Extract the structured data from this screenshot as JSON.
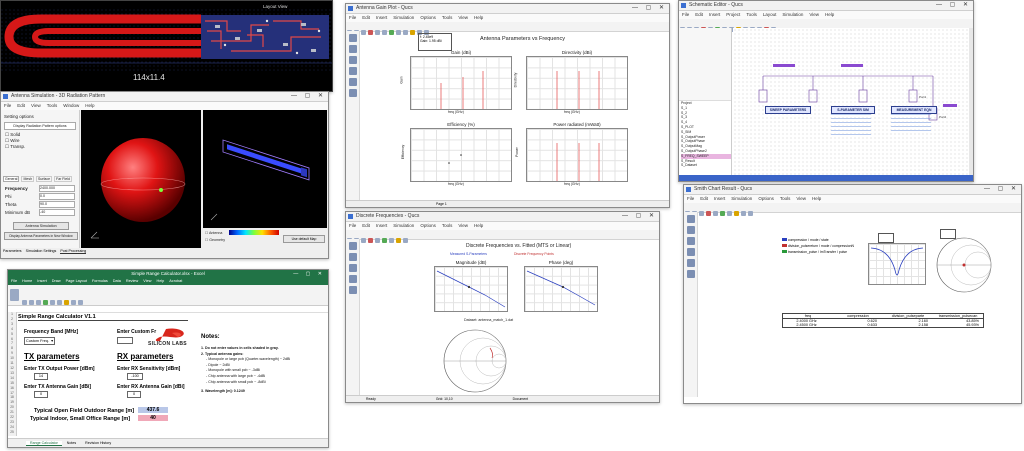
{
  "pcb": {
    "dim_label": "114x11.4",
    "header_label": "Layout View"
  },
  "sim3d": {
    "title": "Antenna Simulation - 3D Radiation Pattern",
    "menus": [
      "File",
      "Edit",
      "View",
      "Tools",
      "Window",
      "Help"
    ],
    "section": "Setting options",
    "settings_button": "Display Radiation Pattern options",
    "options": [
      "Solid",
      "Wire",
      "Transp."
    ],
    "tabs": [
      "General",
      "Mesh",
      "Surface",
      "Far Field"
    ],
    "fields": [
      {
        "label": "Frequency",
        "value": "2400.000"
      },
      {
        "label": "Phi",
        "value": "0.0"
      },
      {
        "label": "Theta",
        "value": "90.0"
      },
      {
        "label": "Minimum dB",
        "value": "-40"
      }
    ],
    "buttons": [
      "Antenna Simulation",
      "Display Antenna Parameters in New Window"
    ],
    "bottom_tabs": [
      "Parameters",
      "Simulation Settings",
      "Post Processing"
    ],
    "right_bottom": [
      "Antenna",
      "Geometry"
    ],
    "color_button": "Use default Map"
  },
  "excel": {
    "title": "Simple Range Calculator.xlsx - Excel",
    "ribbon_tabs": [
      "File",
      "Home",
      "Insert",
      "Draw",
      "Page Layout",
      "Formulas",
      "Data",
      "Review",
      "View",
      "Help",
      "Acrobat"
    ],
    "sheet_title": "Simple Range Calculator V1.1",
    "freq_label": "Frequency Band [MHz]",
    "freq_value": "Custom Freq.",
    "custom_label": "Enter Custom Fr",
    "brand": "SILICON LABS",
    "tx_header": "TX parameters",
    "rx_header": "RX parameters",
    "tx_power_label": "Enter TX Output Power [dBm]",
    "tx_power": "14",
    "rx_sens_label": "Enter RX Sensitivity [dBm]",
    "rx_sens": "-100",
    "tx_gain_label": "Enter TX Antenna Gain [dBi]",
    "tx_gain": "0",
    "rx_gain_label": "Enter RX Antenna Gain [dBi]",
    "rx_gain": "0",
    "outdoor_label": "Typical Open Field Outdoor Range [m]",
    "outdoor_value": "437.6",
    "indoor_label": "Typical Indoor, Small Office Range [m]",
    "indoor_value": "40",
    "notes_title": "Notes:",
    "notes": [
      "1. Do not enter values in cells shaded in gray.",
      "2. Typical antenna gains:",
      "- Monopole or large pcb (Quarter-wavelength) ~ 2dBi",
      "- Dipole ~ 2dBi",
      "- Monopole with small pcb ~ -3dBi",
      "- Chip antenna with large pcb ~ -4dBi",
      "- Chip antenna with small pcb ~ -8dBi",
      "3. Wavelength [m]:   0.1249"
    ],
    "sheet_tabs": [
      "Range Calculator",
      "Notes",
      "Revision History"
    ],
    "row_numbers": [
      "1",
      "2",
      "3",
      "4",
      "5",
      "6",
      "7",
      "8",
      "9",
      "10",
      "11",
      "12",
      "13",
      "14",
      "15",
      "16",
      "17",
      "18",
      "19",
      "20",
      "21",
      "22",
      "23",
      "24",
      "25"
    ]
  },
  "qucs1": {
    "title": "Antenna Gain Plot - Qucs",
    "menus": [
      "File",
      "Edit",
      "Insert",
      "Simulation",
      "Options",
      "Tools",
      "View",
      "Help"
    ],
    "chart_title": "Antenna Parameters vs Frequency",
    "marker": "f: 2.45e9\nGain: 1.95 dBi",
    "plots": [
      {
        "title": "Gain (dBi)",
        "ylabel": "Gain",
        "xlabel": "freq (GHz)"
      },
      {
        "title": "Directivity (dBi)",
        "ylabel": "Directivity",
        "xlabel": "freq (GHz)"
      },
      {
        "title": "Efficiency (%)",
        "ylabel": "Efficiency",
        "xlabel": "freq (GHz)"
      },
      {
        "title": "Power radiated (mWatt)",
        "ylabel": "Power",
        "xlabel": "freq (GHz)"
      }
    ],
    "status": "Page 1"
  },
  "qucs2": {
    "title": "Discrete Frequencies - Qucs",
    "menus": [
      "File",
      "Edit",
      "Insert",
      "Simulation",
      "Options",
      "Tools",
      "View",
      "Help"
    ],
    "chart_title": "Discrete Frequencies vs. Fitted (MTS or Linear)",
    "legend_a": "Measured S-Parameters",
    "legend_b": "Discrete Frequency Points",
    "plots": [
      {
        "title": "Magnitude (dB)"
      },
      {
        "title": "Phase (deg)"
      }
    ],
    "caption": "Dataset: antenna_match_1.dat",
    "status": [
      "Ready",
      "Grid: 10,10",
      "Document"
    ]
  },
  "schematic": {
    "title": "Schematic Editor - Qucs",
    "menus": [
      "File",
      "Edit",
      "Insert",
      "Project",
      "Tools",
      "Layout",
      "Simulation",
      "View",
      "Help"
    ],
    "blocks": [
      "SWEEP PARAMETERS",
      "S-PARAMETER SIM",
      "MEASUREMENT EQN"
    ],
    "tree_items": [
      "Project",
      "S_1",
      "S_2",
      "S_3",
      "S_4",
      "S_PLOT",
      "S_SIM",
      "S_OutputPower",
      "S_OutputPhase",
      "S_OutputMag",
      "S_OutputPhase2",
      "S_OutputNoise",
      "S_OutputReturnLoss",
      "S_FREQ_SWEEP",
      "S_Result",
      "S_Dataset",
      "S_Verification"
    ],
    "selected": "S_FREQ_SWEEP"
  },
  "qucs3": {
    "title": "Smith Chart Result - Qucs",
    "menus": [
      "File",
      "Edit",
      "Insert",
      "Simulation",
      "Options",
      "Tools",
      "View",
      "Help"
    ],
    "legend": [
      "compression / mode / state",
      "division_pulsereturn / mode / compressionN",
      "transmission_pulse / ImTransfer / pulse"
    ],
    "table_headers": [
      "freq",
      "compression",
      "division_pulseparte",
      "transmission_pulsecan"
    ],
    "table_rows": [
      [
        "2.4000 GHz",
        "0.620",
        "2.160",
        "43.85%"
      ],
      [
        "2.4500 GHz",
        "0.633",
        "2.158",
        "45.93%"
      ]
    ]
  }
}
